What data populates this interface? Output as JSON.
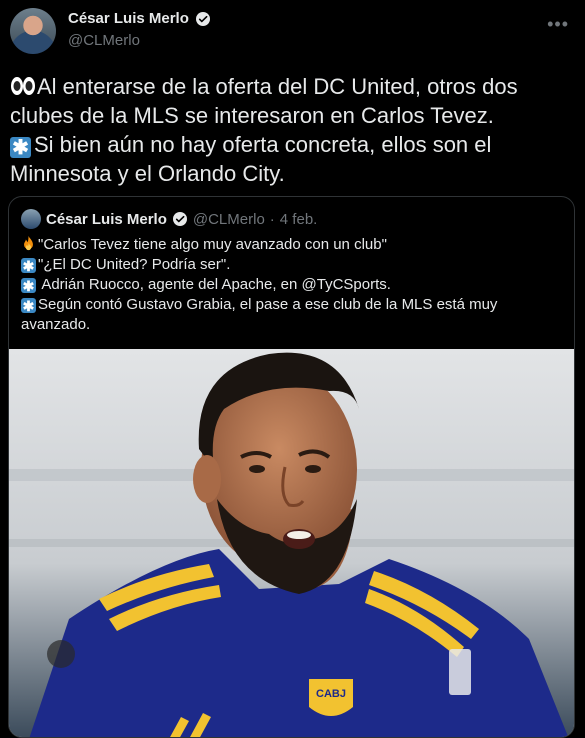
{
  "author": {
    "name": "César Luis Merlo",
    "handle": "@CLMerlo"
  },
  "tweet": {
    "line1": "Al enterarse de la oferta del DC United, otros dos clubes de la MLS se interesaron en Carlos Tevez.",
    "line2": "Si bien aún no hay oferta concreta, ellos son el Minnesota y el Orlando City."
  },
  "quoted": {
    "name": "César Luis Merlo",
    "handle": "@CLMerlo",
    "separator": "·",
    "date": "4 feb.",
    "lines": [
      "\"Carlos Tevez tiene algo muy avanzado con un club\"",
      "\"¿El DC United? Podría ser\".",
      " Adrián Ruocco, agente del Apache, en @TyCSports.",
      "Según contó Gustavo Grabia, el pase a ese club de la MLS está muy avanzado."
    ],
    "photo_badge": "CABJ"
  },
  "icons": {
    "more": "more-icon",
    "verified": "verified-badge-icon",
    "eyes": "eyes-emoji-icon",
    "asterisk": "asterisk-emoji-icon",
    "fire": "fire-emoji-icon"
  },
  "colors": {
    "background": "#000000",
    "text": "#e7e9ea",
    "secondary": "#71767b",
    "verified": "#1d9bf0",
    "border": "#2f3336",
    "asterisk": "#3b88c3"
  }
}
